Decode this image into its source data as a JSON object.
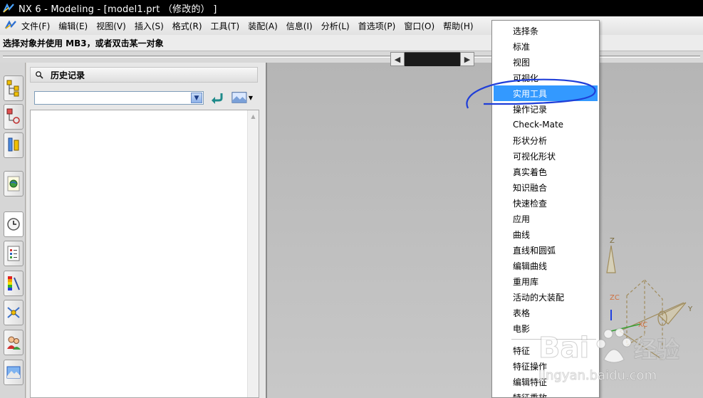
{
  "window": {
    "title": "NX 6 - Modeling - [model1.prt （修改的） ]",
    "app_icon": "nx-logo-icon"
  },
  "menubar": {
    "items": [
      "文件(F)",
      "编辑(E)",
      "视图(V)",
      "插入(S)",
      "格式(R)",
      "工具(T)",
      "装配(A)",
      "信息(I)",
      "分析(L)",
      "首选项(P)",
      "窗口(O)",
      "帮助(H)"
    ]
  },
  "status": {
    "prompt": "选择对象并使用 MB3，或者双击某一对象"
  },
  "resource_bar": {
    "tabs": [
      "assembly-navigator-icon",
      "constraint-navigator-icon",
      "part-navigator-icon",
      "web-browser-icon",
      "history-icon",
      "reuse-library-icon",
      "color-palette-icon",
      "process-studio-icon",
      "roles-icon",
      "system-scenes-icon"
    ],
    "active_tab": "history-icon"
  },
  "history_panel": {
    "title": "历史记录",
    "combo_value": ""
  },
  "context_menu": {
    "items": [
      "选择条",
      "标准",
      "视图",
      "可视化",
      "实用工具",
      "操作记录",
      "Check-Mate",
      "形状分析",
      "可视化形状",
      "真实着色",
      "知识融合",
      "快速检查",
      "应用",
      "曲线",
      "直线和圆弧",
      "编辑曲线",
      "重用库",
      "活动的大装配",
      "表格",
      "电影",
      "特征",
      "特征操作",
      "编辑特征",
      "特征重放"
    ],
    "highlighted": "实用工具"
  },
  "triad": {
    "zc_label": "ZC",
    "xc_label": "XC",
    "z_label": "Z",
    "y_label": "Y",
    "x_label": "X"
  },
  "watermark": {
    "brand": "Bai",
    "brand_suffix": "经验",
    "url": "jingyan.baidu.com"
  },
  "colors": {
    "titlebar": "#000000",
    "highlight": "#3399ff",
    "annotation": "#1f3ed8",
    "viewport": "#bdbdbd"
  }
}
